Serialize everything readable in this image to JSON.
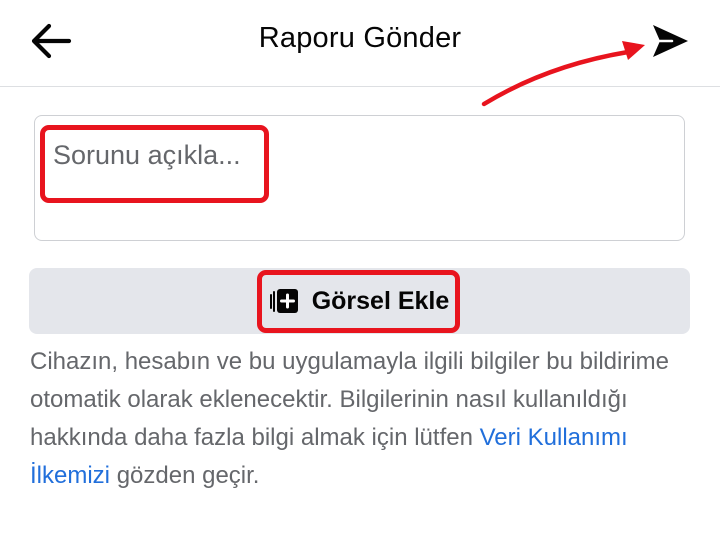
{
  "header": {
    "title": "Raporu Gönder",
    "back_icon": "arrow-left-icon",
    "send_icon": "send-icon"
  },
  "form": {
    "description_placeholder": "Sorunu açıkla...",
    "add_image_label": "Görsel Ekle",
    "add_image_icon": "add-photo-icon"
  },
  "info": {
    "text_before_link": "Cihazın, hesabın ve bu uygulamayla ilgili bilgiler bu bildirime otomatik olarak eklenecektir. Bilgilerinin nasıl kullanıldığı hakkında daha fazla bilgi almak için lütfen",
    "link_text": "Veri Kullanımı İlkemizi",
    "text_after_link": "gözden geçir."
  },
  "colors": {
    "annotation_red": "#e8141e",
    "link_blue": "#216fdb",
    "button_gray": "#e4e6eb",
    "secondary_text": "#65676b"
  }
}
